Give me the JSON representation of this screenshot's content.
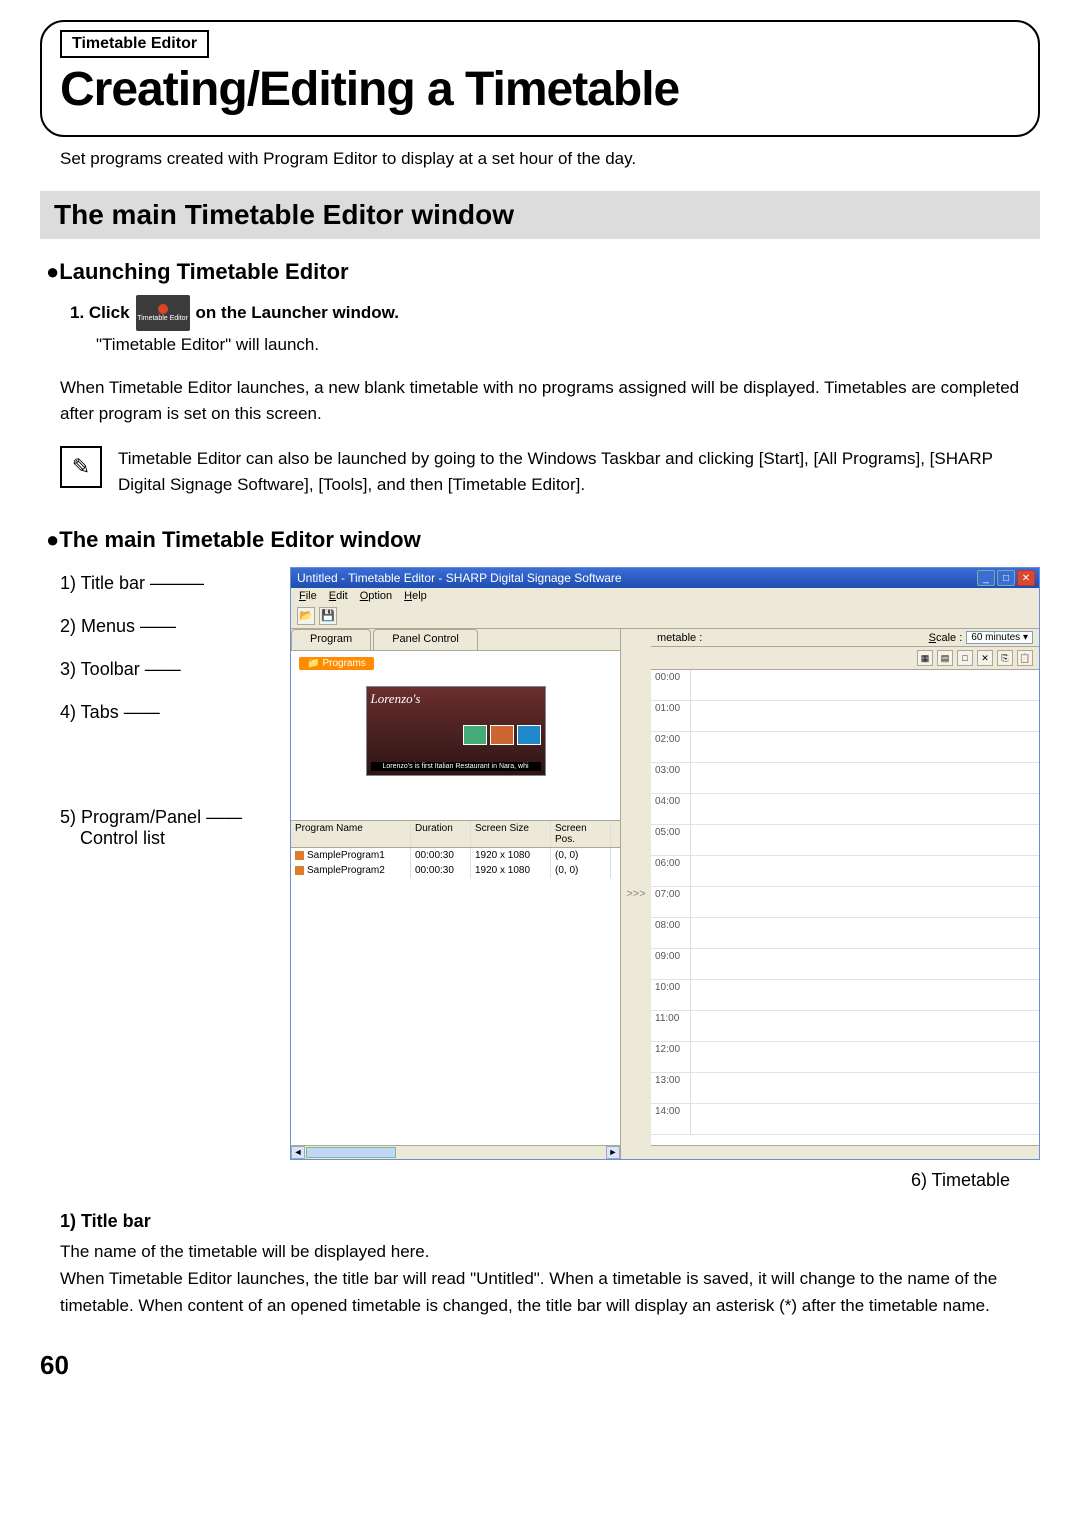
{
  "header": {
    "tag": "Timetable Editor",
    "title": "Creating/Editing a Timetable"
  },
  "intro": "Set programs created with Program Editor to display at a set hour of the day.",
  "section_banner": "The main Timetable Editor window",
  "sub1": {
    "heading": "●Launching Timetable Editor",
    "step_prefix": "1.  Click",
    "icon_label": "Timetable Editor",
    "step_suffix": "on the Launcher window.",
    "result": "\"Timetable Editor\" will launch."
  },
  "body_para": "When Timetable Editor launches, a new blank timetable with no programs assigned will be displayed. Timetables are completed after program is set on this screen.",
  "tip": "Timetable Editor can also be launched by going to the Windows Taskbar and clicking [Start], [All Programs], [SHARP Digital Signage Software], [Tools], and then [Timetable Editor].",
  "sub2": "●The main Timetable Editor window",
  "callouts": {
    "c1": "1) Title bar",
    "c2": "2) Menus",
    "c3": "3) Toolbar",
    "c4": "4) Tabs",
    "c5a": "5) Program/Panel",
    "c5b": "Control list",
    "c6": "6) Timetable"
  },
  "app": {
    "title": "Untitled - Timetable Editor - SHARP Digital Signage Software",
    "menus": {
      "file": "File",
      "edit": "Edit",
      "option": "Option",
      "help": "Help"
    },
    "tabs": {
      "program": "Program",
      "panel": "Panel Control"
    },
    "programs_chip": "Programs",
    "thumb_logo": "Lorenzo's",
    "thumb_caption": "Lorenzo's is first Italian Restaurant in Nara, whi",
    "list": {
      "headers": {
        "name": "Program Name",
        "dur": "Duration",
        "size": "Screen Size",
        "pos": "Screen Pos."
      },
      "rows": [
        {
          "swatch": "#e07b2e",
          "name": "SampleProgram1",
          "dur": "00:00:30",
          "size": "1920 x 1080",
          "pos": "(0, 0)"
        },
        {
          "swatch": "#e07b2e",
          "name": "SampleProgram2",
          "dur": "00:00:30",
          "size": "1920 x 1080",
          "pos": "(0, 0)"
        }
      ]
    },
    "gutter": ">>>",
    "right": {
      "label": "metable :",
      "scale_label": "Scale :",
      "scale_value": "60 minutes",
      "hours": [
        "00:00",
        "01:00",
        "02:00",
        "03:00",
        "04:00",
        "05:00",
        "06:00",
        "07:00",
        "08:00",
        "09:00",
        "10:00",
        "11:00",
        "12:00",
        "13:00",
        "14:00"
      ]
    }
  },
  "description": {
    "heading": "1) Title bar",
    "text": "The name of the timetable will be displayed here.\nWhen Timetable Editor launches, the title bar will read \"Untitled\". When a timetable is saved, it will change to the name of the timetable. When content of an opened timetable is changed, the title bar will display an asterisk (*) after the timetable name."
  },
  "page_number": "60"
}
